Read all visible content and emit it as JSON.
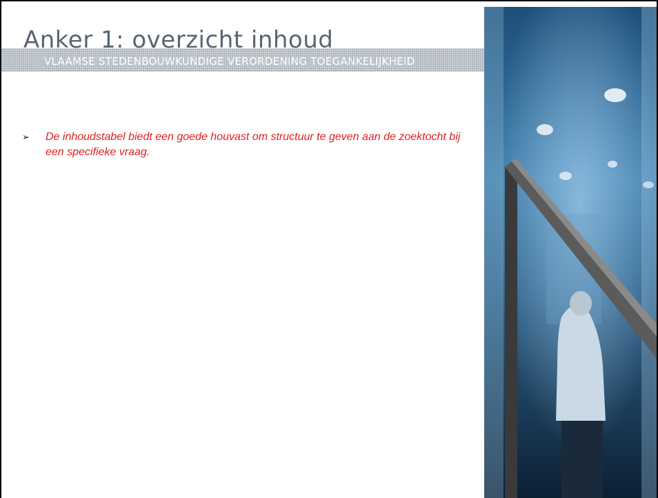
{
  "slide": {
    "title": "Anker 1: overzicht inhoud",
    "subtitle": "VLAAMSE STEDENBOUWKUNDIGE VERORDENING TOEGANKELIJKHEID",
    "bullets": [
      {
        "icon": "arrow-bullet-icon",
        "text": "De inhoudstabel biedt een goede houvast om structuur te geven aan de zoektocht bij een specifieke vraag."
      }
    ]
  },
  "colors": {
    "title": "#5a6470",
    "band": "#aab3bc",
    "bullet_text": "#e02020"
  }
}
